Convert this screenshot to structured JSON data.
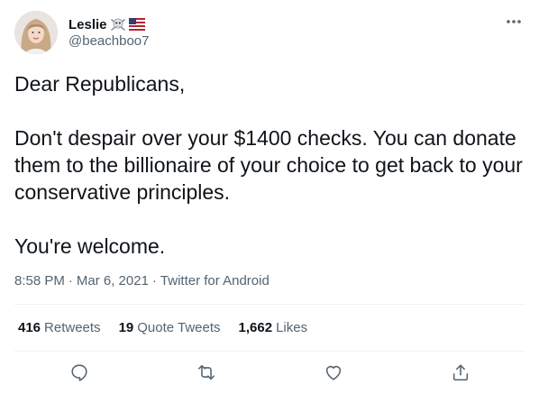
{
  "author": {
    "display_name": "Leslie",
    "handle": "@beachboo7",
    "name_emojis": [
      "skull-crossbones-icon",
      "us-flag-icon"
    ]
  },
  "tweet": {
    "paragraphs": [
      "Dear Republicans,",
      "Don't despair over your $1400 checks. You can donate them to the billionaire of your choice to get back to your conservative principles.",
      "You're welcome."
    ],
    "time": "8:58 PM",
    "separator": "·",
    "date": "Mar 6, 2021",
    "source": "Twitter for Android"
  },
  "stats": {
    "retweets_count": "416",
    "retweets_label": "Retweets",
    "quotes_count": "19",
    "quotes_label": "Quote Tweets",
    "likes_count": "1,662",
    "likes_label": "Likes"
  },
  "actions": [
    "reply-icon",
    "retweet-icon",
    "like-icon",
    "share-icon"
  ],
  "colors": {
    "text_primary": "#0f1419",
    "text_secondary": "#536471",
    "divider": "#eff3f4",
    "icon": "#536471",
    "flag_red": "#b22234",
    "flag_blue": "#3c3b6e"
  }
}
